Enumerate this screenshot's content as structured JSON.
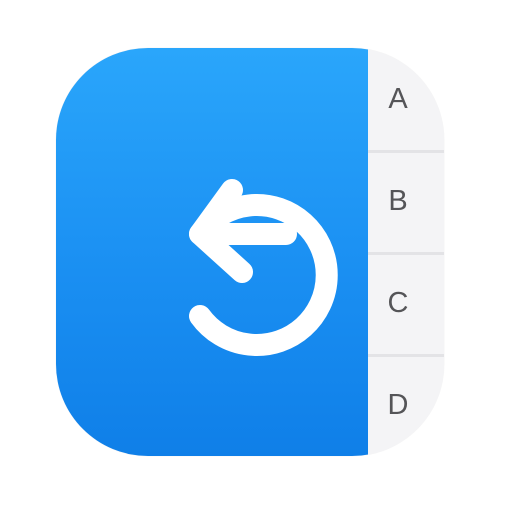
{
  "app_icon": {
    "icon": "undo-icon",
    "colors": {
      "panel_top": "#2aa6fb",
      "panel_bottom": "#0f7fe8",
      "tab_bg": "#f4f4f6",
      "tab_divider": "#e3e3e6",
      "tab_text": "#555558",
      "glyph": "#ffffff"
    },
    "tabs": [
      {
        "label": "A"
      },
      {
        "label": "B"
      },
      {
        "label": "C"
      },
      {
        "label": "D"
      }
    ]
  }
}
